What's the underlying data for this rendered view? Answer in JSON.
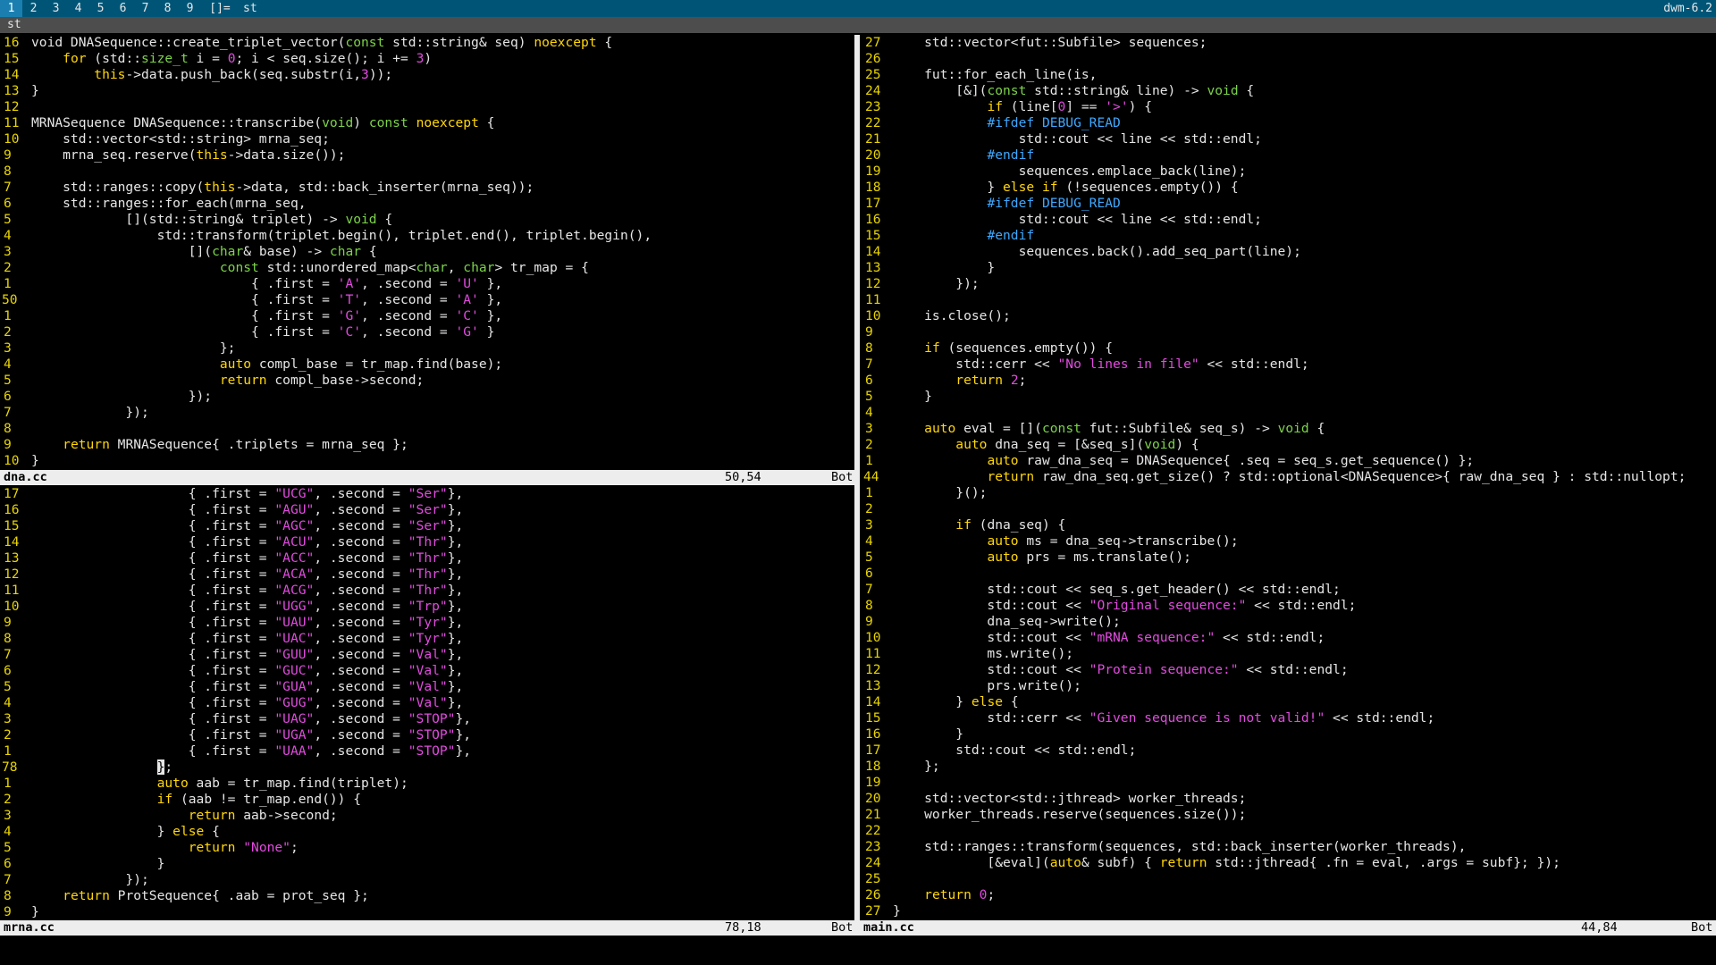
{
  "bar": {
    "tags": [
      "1",
      "2",
      "3",
      "4",
      "5",
      "6",
      "7",
      "8",
      "9"
    ],
    "layout": "[]=",
    "title": "st",
    "status": "dwm-6.2"
  },
  "window_title": "st",
  "panes": {
    "dna": {
      "file": "dna.cc",
      "position": "50,54",
      "scroll": "Bot",
      "lines": [
        {
          "n": "16",
          "h": "void DNASequence::create_triplet_vector(<t>const</t> std::string& seq) <k>noexcept</k> {"
        },
        {
          "n": "15",
          "h": "    <k>for</k> (std::<t>size_t</t> i = <n>0</n>; i < seq.size(); i += <n>3</n>)"
        },
        {
          "n": "14",
          "h": "        <k>this</k>->data.push_back(seq.substr(i,<n>3</n>));"
        },
        {
          "n": "13",
          "h": "}"
        },
        {
          "n": "12",
          "h": ""
        },
        {
          "n": "11",
          "h": "MRNASequence DNASequence::transcribe(<t>void</t>) <t>const</t> <k>noexcept</k> {"
        },
        {
          "n": "10",
          "h": "    std::vector<std::string> mrna_seq;"
        },
        {
          "n": "9",
          "h": "    mrna_seq.reserve(<k>this</k>->data.size());"
        },
        {
          "n": "8",
          "h": ""
        },
        {
          "n": "7",
          "h": "    std::ranges::copy(<k>this</k>->data, std::back_inserter(mrna_seq));"
        },
        {
          "n": "6",
          "h": "    std::ranges::for_each(mrna_seq,"
        },
        {
          "n": "5",
          "h": "            [](std::string& triplet) -> <t>void</t> {"
        },
        {
          "n": "4",
          "h": "                std::transform(triplet.begin(), triplet.end(), triplet.begin(),"
        },
        {
          "n": "3",
          "h": "                    [](<t>char</t>& base) -> <t>char</t> {"
        },
        {
          "n": "2",
          "h": "                        <t>const</t> std::unordered_map<<t>char</t>, <t>char</t>> tr_map = {"
        },
        {
          "n": "1",
          "h": "                            { .first = <s>'A'</s>, .second = <s>'U'</s> },"
        },
        {
          "n": "50",
          "h": "                            { .first = <s>'T'</s>, .second = <s>'A'</s> },",
          "cur": true
        },
        {
          "n": "1",
          "h": "                            { .first = <s>'G'</s>, .second = <s>'C'</s> },"
        },
        {
          "n": "2",
          "h": "                            { .first = <s>'C'</s>, .second = <s>'G'</s> }"
        },
        {
          "n": "3",
          "h": "                        };"
        },
        {
          "n": "4",
          "h": "                        <k>auto</k> compl_base = tr_map.find(base);"
        },
        {
          "n": "5",
          "h": "                        <k>return</k> compl_base->second;"
        },
        {
          "n": "6",
          "h": "                    });"
        },
        {
          "n": "7",
          "h": "            });"
        },
        {
          "n": "8",
          "h": ""
        },
        {
          "n": "9",
          "h": "    <k>return</k> MRNASequence{ .triplets = mrna_seq };"
        },
        {
          "n": "10",
          "h": "}"
        }
      ]
    },
    "mrna": {
      "file": "mrna.cc",
      "position": "78,18",
      "scroll": "Bot",
      "lines": [
        {
          "n": "17",
          "h": "                    { .first = <s>\"UCG\"</s>, .second = <s>\"Ser\"</s>},"
        },
        {
          "n": "16",
          "h": "                    { .first = <s>\"AGU\"</s>, .second = <s>\"Ser\"</s>},"
        },
        {
          "n": "15",
          "h": "                    { .first = <s>\"AGC\"</s>, .second = <s>\"Ser\"</s>},"
        },
        {
          "n": "14",
          "h": "                    { .first = <s>\"ACU\"</s>, .second = <s>\"Thr\"</s>},"
        },
        {
          "n": "13",
          "h": "                    { .first = <s>\"ACC\"</s>, .second = <s>\"Thr\"</s>},"
        },
        {
          "n": "12",
          "h": "                    { .first = <s>\"ACA\"</s>, .second = <s>\"Thr\"</s>},"
        },
        {
          "n": "11",
          "h": "                    { .first = <s>\"ACG\"</s>, .second = <s>\"Thr\"</s>},"
        },
        {
          "n": "10",
          "h": "                    { .first = <s>\"UGG\"</s>, .second = <s>\"Trp\"</s>},"
        },
        {
          "n": "9",
          "h": "                    { .first = <s>\"UAU\"</s>, .second = <s>\"Tyr\"</s>},"
        },
        {
          "n": "8",
          "h": "                    { .first = <s>\"UAC\"</s>, .second = <s>\"Tyr\"</s>},"
        },
        {
          "n": "7",
          "h": "                    { .first = <s>\"GUU\"</s>, .second = <s>\"Val\"</s>},"
        },
        {
          "n": "6",
          "h": "                    { .first = <s>\"GUC\"</s>, .second = <s>\"Val\"</s>},"
        },
        {
          "n": "5",
          "h": "                    { .first = <s>\"GUA\"</s>, .second = <s>\"Val\"</s>},"
        },
        {
          "n": "4",
          "h": "                    { .first = <s>\"GUG\"</s>, .second = <s>\"Val\"</s>},"
        },
        {
          "n": "3",
          "h": "                    { .first = <s>\"UAG\"</s>, .second = <s>\"STOP\"</s>},"
        },
        {
          "n": "2",
          "h": "                    { .first = <s>\"UGA\"</s>, .second = <s>\"STOP\"</s>},"
        },
        {
          "n": "1",
          "h": "                    { .first = <s>\"UAA\"</s>, .second = <s>\"STOP\"</s>},"
        },
        {
          "n": "78",
          "h": "                <c>}</c>;",
          "cur": true
        },
        {
          "n": "1",
          "h": "                <k>auto</k> aab = tr_map.find(triplet);"
        },
        {
          "n": "2",
          "h": "                <k>if</k> (aab != tr_map.end()) {"
        },
        {
          "n": "3",
          "h": "                    <k>return</k> aab->second;"
        },
        {
          "n": "4",
          "h": "                } <k>else</k> {"
        },
        {
          "n": "5",
          "h": "                    <k>return</k> <s>\"None\"</s>;"
        },
        {
          "n": "6",
          "h": "                }"
        },
        {
          "n": "7",
          "h": "            });"
        },
        {
          "n": "8",
          "h": "    <k>return</k> ProtSequence{ .aab = prot_seq };"
        },
        {
          "n": "9",
          "h": "}"
        }
      ]
    },
    "main": {
      "file": "main.cc",
      "position": "44,84",
      "scroll": "Bot",
      "lines": [
        {
          "n": "27",
          "h": "    std::vector<fut::Subfile> sequences;"
        },
        {
          "n": "26",
          "h": ""
        },
        {
          "n": "25",
          "h": "    fut::for_each_line(is,"
        },
        {
          "n": "24",
          "h": "        [&](<t>const</t> std::string& line) -> <t>void</t> {"
        },
        {
          "n": "23",
          "h": "            <k>if</k> (line[<n>0</n>] == <s>'>'</s>) {"
        },
        {
          "n": "22",
          "h": "            <p>#ifdef DEBUG_READ</p>"
        },
        {
          "n": "21",
          "h": "                std::cout << line << std::endl;"
        },
        {
          "n": "20",
          "h": "            <p>#endif</p>"
        },
        {
          "n": "19",
          "h": "                sequences.emplace_back(line);"
        },
        {
          "n": "18",
          "h": "            } <k>else</k> <k>if</k> (!sequences.empty()) {"
        },
        {
          "n": "17",
          "h": "            <p>#ifdef DEBUG_READ</p>"
        },
        {
          "n": "16",
          "h": "                std::cout << line << std::endl;"
        },
        {
          "n": "15",
          "h": "            <p>#endif</p>"
        },
        {
          "n": "14",
          "h": "                sequences.back().add_seq_part(line);"
        },
        {
          "n": "13",
          "h": "            }"
        },
        {
          "n": "12",
          "h": "        });"
        },
        {
          "n": "11",
          "h": ""
        },
        {
          "n": "10",
          "h": "    is.close();"
        },
        {
          "n": "9",
          "h": ""
        },
        {
          "n": "8",
          "h": "    <k>if</k> (sequences.empty()) {"
        },
        {
          "n": "7",
          "h": "        std::cerr << <s>\"No lines in file\"</s> << std::endl;"
        },
        {
          "n": "6",
          "h": "        <k>return</k> <n>2</n>;"
        },
        {
          "n": "5",
          "h": "    }"
        },
        {
          "n": "4",
          "h": ""
        },
        {
          "n": "3",
          "h": "    <k>auto</k> eval = [](<t>const</t> fut::Subfile& seq_s) -> <t>void</t> {"
        },
        {
          "n": "2",
          "h": "        <k>auto</k> dna_seq = [&seq_s](<t>void</t>) {"
        },
        {
          "n": "1",
          "h": "            <k>auto</k> raw_dna_seq = DNASequence{ .seq = seq_s.get_sequence() };"
        },
        {
          "n": "44",
          "h": "            <k>return</k> raw_dna_seq.get_size() ? std::optional<DNASequence>{ raw_dna_seq } : std::nullopt;",
          "cur": true
        },
        {
          "n": "1",
          "h": "        }();"
        },
        {
          "n": "2",
          "h": ""
        },
        {
          "n": "3",
          "h": "        <k>if</k> (dna_seq) {"
        },
        {
          "n": "4",
          "h": "            <k>auto</k> ms = dna_seq->transcribe();"
        },
        {
          "n": "5",
          "h": "            <k>auto</k> prs = ms.translate();"
        },
        {
          "n": "6",
          "h": ""
        },
        {
          "n": "7",
          "h": "            std::cout << seq_s.get_header() << std::endl;"
        },
        {
          "n": "8",
          "h": "            std::cout << <s>\"Original sequence:\"</s> << std::endl;"
        },
        {
          "n": "9",
          "h": "            dna_seq->write();"
        },
        {
          "n": "10",
          "h": "            std::cout << <s>\"mRNA sequence:\"</s> << std::endl;"
        },
        {
          "n": "11",
          "h": "            ms.write();"
        },
        {
          "n": "12",
          "h": "            std::cout << <s>\"Protein sequence:\"</s> << std::endl;"
        },
        {
          "n": "13",
          "h": "            prs.write();"
        },
        {
          "n": "14",
          "h": "        } <k>else</k> {"
        },
        {
          "n": "15",
          "h": "            std::cerr << <s>\"Given sequence is not valid!\"</s> << std::endl;"
        },
        {
          "n": "16",
          "h": "        }"
        },
        {
          "n": "17",
          "h": "        std::cout << std::endl;"
        },
        {
          "n": "18",
          "h": "    };"
        },
        {
          "n": "19",
          "h": ""
        },
        {
          "n": "20",
          "h": "    std::vector<std::jthread> worker_threads;"
        },
        {
          "n": "21",
          "h": "    worker_threads.reserve(sequences.size());"
        },
        {
          "n": "22",
          "h": ""
        },
        {
          "n": "23",
          "h": "    std::ranges::transform(sequences, std::back_inserter(worker_threads),"
        },
        {
          "n": "24",
          "h": "            [&eval](<k>auto</k>& subf) { <k>return</k> std::jthread{ .fn = eval, .args = subf}; });"
        },
        {
          "n": "25",
          "h": ""
        },
        {
          "n": "26",
          "h": "    <k>return</k> <n>0</n>;"
        },
        {
          "n": "27",
          "h": "}"
        }
      ]
    }
  },
  "colors": {
    "bar_bg": "#005577",
    "bar_selected": "#1a7fb0",
    "line_number": "#e8d400",
    "keyword": "#ffd60a",
    "type": "#7cd34a",
    "string": "#e24be0",
    "preprocessor": "#3ea8ff",
    "statusline_bg": "#ededed"
  }
}
